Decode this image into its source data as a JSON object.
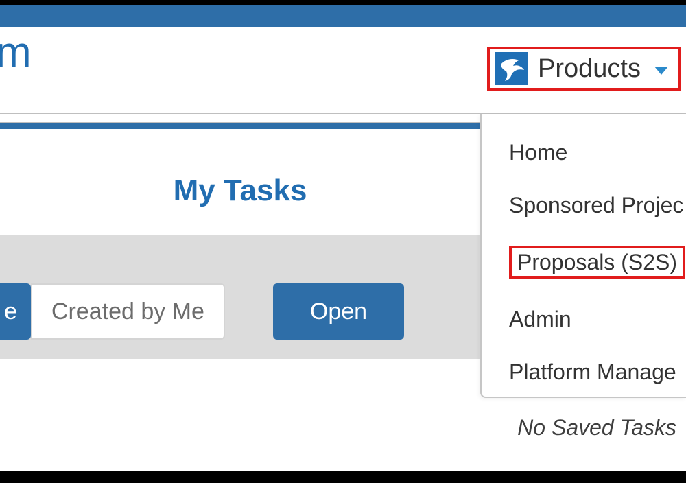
{
  "header": {
    "logo_fragment": "m",
    "products_label": "Products"
  },
  "section": {
    "title": "My Tasks"
  },
  "filters": {
    "primary_fragment": "e",
    "created_by_me": "Created by Me",
    "open": "Open"
  },
  "menu": {
    "items": [
      "Home",
      "Sponsored Projec",
      "Proposals (S2S)",
      "Admin",
      "Platform Manage"
    ],
    "highlighted_index": 2
  },
  "footer": {
    "no_saved_tasks": "No Saved Tasks"
  }
}
